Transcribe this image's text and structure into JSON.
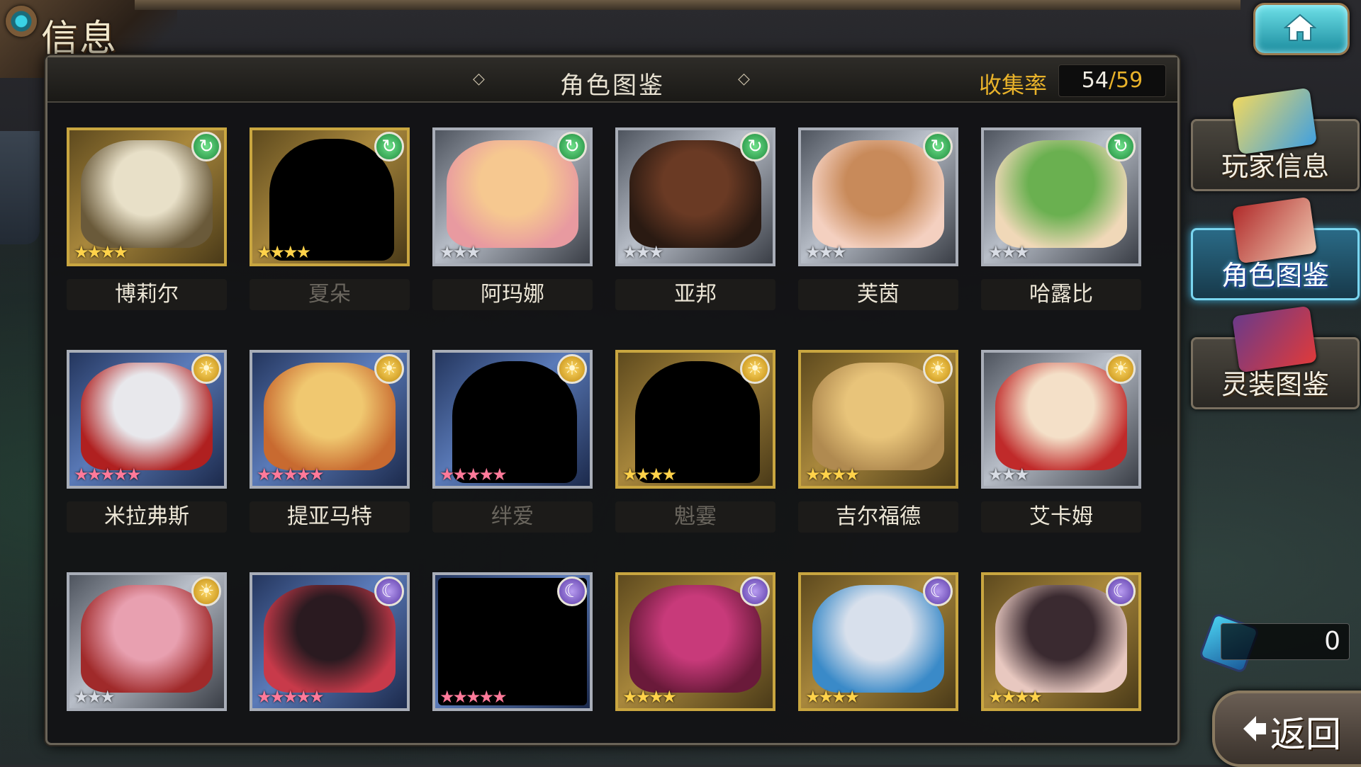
{
  "header": {
    "title": "信息"
  },
  "panel": {
    "title": "角色图鉴",
    "collect_label": "收集率",
    "collect_current": "54",
    "collect_separator": "/",
    "collect_total": "59"
  },
  "cards": [
    {
      "name": "博莉尔",
      "locked": false,
      "element": "wind",
      "frame": "gold",
      "stars": 4,
      "star_style": "gold",
      "portrait": [
        "#e8e0c8",
        "#6a5a3a"
      ]
    },
    {
      "name": "夏朵",
      "locked": true,
      "element": "wind",
      "frame": "gold",
      "stars": 4,
      "star_style": "gold",
      "portrait": null
    },
    {
      "name": "阿玛娜",
      "locked": false,
      "element": "wind",
      "frame": "silver",
      "stars": 3,
      "star_style": "silver",
      "portrait": [
        "#f6c890",
        "#e89aa0"
      ]
    },
    {
      "name": "亚邦",
      "locked": false,
      "element": "wind",
      "frame": "silver",
      "stars": 3,
      "star_style": "silver",
      "portrait": [
        "#6a3a24",
        "#2a1a12"
      ]
    },
    {
      "name": "芙茵",
      "locked": false,
      "element": "wind",
      "frame": "silver",
      "stars": 3,
      "star_style": "silver",
      "portrait": [
        "#c88a5a",
        "#f4d0c0"
      ]
    },
    {
      "name": "哈露比",
      "locked": false,
      "element": "wind",
      "frame": "silver",
      "stars": 3,
      "star_style": "silver",
      "portrait": [
        "#6ab050",
        "#f0d8b8"
      ]
    },
    {
      "name": "米拉弗斯",
      "locked": false,
      "element": "sun",
      "frame": "blue",
      "stars": 5,
      "star_style": "rainbow",
      "portrait": [
        "#e8e8ec",
        "#b02020"
      ]
    },
    {
      "name": "提亚马特",
      "locked": false,
      "element": "sun",
      "frame": "blue",
      "stars": 5,
      "star_style": "rainbow",
      "portrait": [
        "#f0c870",
        "#c86a30"
      ]
    },
    {
      "name": "绊爱",
      "locked": true,
      "element": "sun",
      "frame": "blue",
      "stars": 5,
      "star_style": "rainbow",
      "portrait": null
    },
    {
      "name": "魁霎",
      "locked": true,
      "element": "sun",
      "frame": "gold",
      "stars": 4,
      "star_style": "gold",
      "portrait": null
    },
    {
      "name": "吉尔福德",
      "locked": false,
      "element": "sun",
      "frame": "gold",
      "stars": 4,
      "star_style": "gold",
      "portrait": [
        "#e8c47a",
        "#b08a50"
      ]
    },
    {
      "name": "艾卡姆",
      "locked": false,
      "element": "sun",
      "frame": "silver",
      "stars": 3,
      "star_style": "silver",
      "portrait": [
        "#f4e0c8",
        "#c02a2a"
      ]
    },
    {
      "name": "",
      "locked": false,
      "element": "sun",
      "frame": "silver",
      "stars": 3,
      "star_style": "silver",
      "portrait": [
        "#e8a0b0",
        "#a02a2a"
      ]
    },
    {
      "name": "",
      "locked": false,
      "element": "moon",
      "frame": "blue",
      "stars": 5,
      "star_style": "rainbow",
      "portrait": [
        "#2a1a20",
        "#c83a4a"
      ]
    },
    {
      "name": "",
      "locked": true,
      "element": "moon",
      "frame": "blue",
      "stars": 5,
      "star_style": "rainbow",
      "portrait": null
    },
    {
      "name": "",
      "locked": false,
      "element": "moon",
      "frame": "gold",
      "stars": 4,
      "star_style": "gold",
      "portrait": [
        "#c83a7a",
        "#6a1a3a"
      ]
    },
    {
      "name": "",
      "locked": false,
      "element": "moon",
      "frame": "gold",
      "stars": 4,
      "star_style": "gold",
      "portrait": [
        "#d8e0ec",
        "#3a8ac8"
      ]
    },
    {
      "name": "",
      "locked": false,
      "element": "moon",
      "frame": "gold",
      "stars": 4,
      "star_style": "gold",
      "portrait": [
        "#3a2a30",
        "#e8c8c0"
      ]
    }
  ],
  "sidebar": [
    {
      "label": "玩家信息",
      "active": false,
      "icon": "player-info-icon",
      "icon_colors": [
        "#f0d860",
        "#40a0e0"
      ]
    },
    {
      "label": "角色图鉴",
      "active": true,
      "icon": "character-book-icon",
      "icon_colors": [
        "#b02a2a",
        "#f0c8b0"
      ]
    },
    {
      "label": "灵装图鉴",
      "active": false,
      "icon": "gear-book-icon",
      "icon_colors": [
        "#6a3a8a",
        "#e03a3a"
      ]
    }
  ],
  "currency": {
    "value": "0",
    "icon": "crystal-icon"
  },
  "back_button": {
    "label": "返回"
  },
  "colors": {
    "accent_gold": "#e8b22a",
    "active_blue": "#7ad6f0"
  }
}
